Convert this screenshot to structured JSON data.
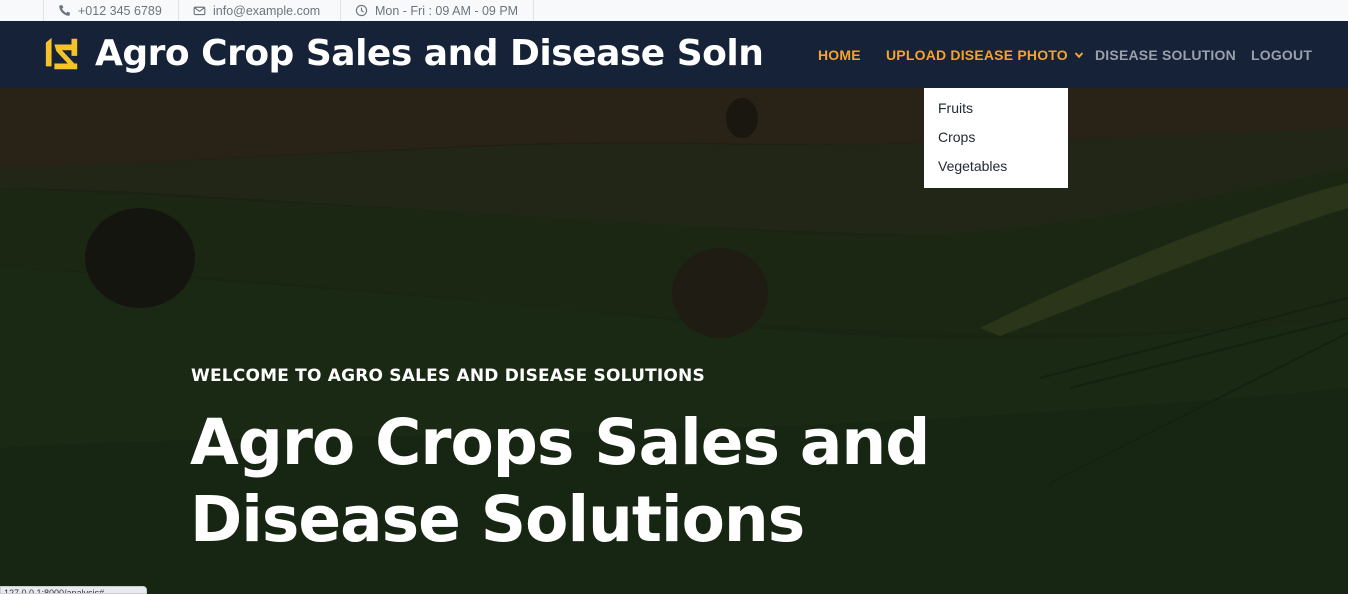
{
  "topbar": {
    "phone": "+012 345 6789",
    "email": "info@example.com",
    "hours": "Mon - Fri : 09 AM - 09 PM"
  },
  "navbar": {
    "brand": "Agro Crop Sales and Disease Soln",
    "items": [
      {
        "label": "HOME",
        "active": true
      },
      {
        "label": "UPLOAD DISEASE PHOTO",
        "active": true,
        "has_dropdown": true
      },
      {
        "label": "DISEASE SOLUTION",
        "active": false
      },
      {
        "label": "LOGOUT",
        "active": false
      }
    ],
    "dropdown": [
      "Fruits",
      "Crops",
      "Vegetables"
    ]
  },
  "hero": {
    "eyebrow": "WELCOME TO AGRO SALES AND DISEASE SOLUTIONS",
    "headline_line1": "Agro Crops Sales and",
    "headline_line2": "Disease Solutions"
  },
  "status_bar": "127.0.0.1:8000/analysis#",
  "colors": {
    "navbar_bg": "#162238",
    "accent": "#f6a22c",
    "nav_inactive": "#9aa0aa",
    "topbar_bg": "#f8f9fb"
  },
  "icons": {
    "phone": "phone-icon",
    "email": "envelope-icon",
    "hours": "clock-icon",
    "logo": "brand-logo-icon",
    "dropdown": "chevron-down-icon"
  }
}
